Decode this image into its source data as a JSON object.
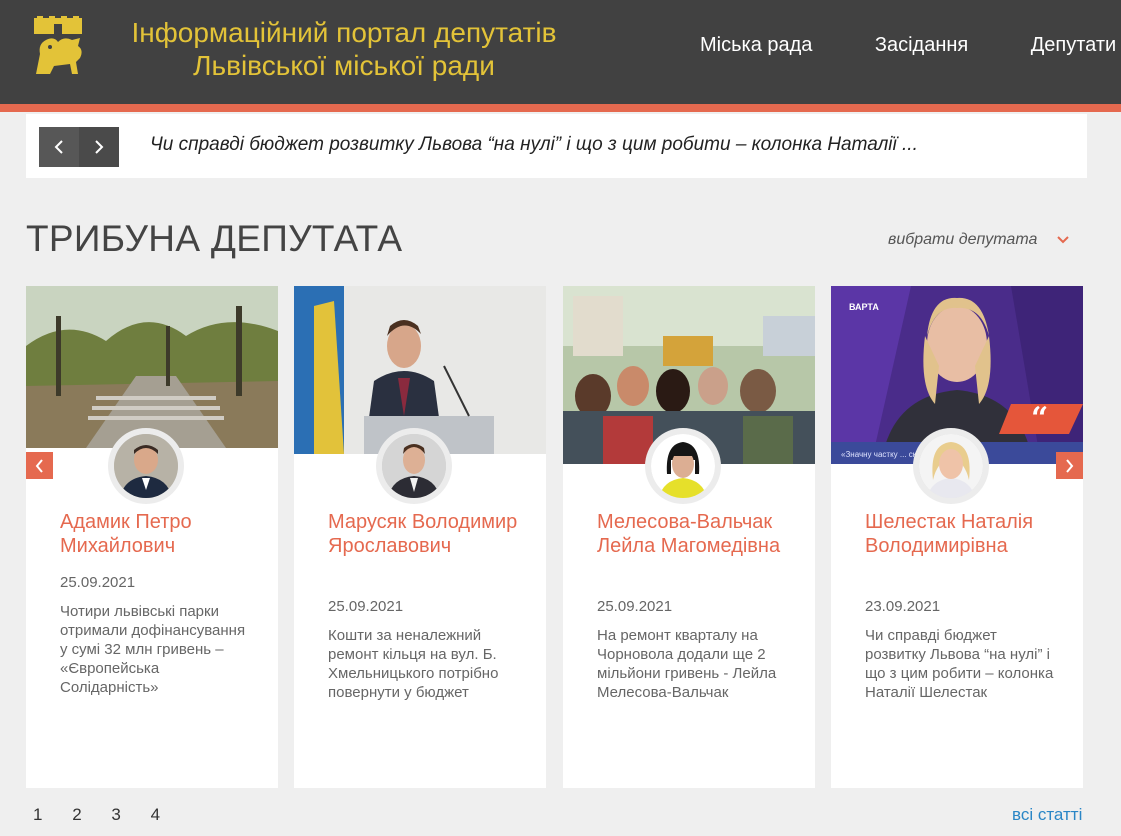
{
  "header": {
    "title_line1": "Інформаційний портал депутатів",
    "title_line2": "Львівської міської ради",
    "nav": [
      "Міська рада",
      "Засідання",
      "Депутати"
    ]
  },
  "ticker": {
    "text": "Чи справді бюджет розвитку Львова “на нулі” і що з цим робити – колонка Наталії ..."
  },
  "section": {
    "title": "ТРИБУНА ДЕПУТАТА",
    "pick_label": "вибрати депутата"
  },
  "cards": [
    {
      "name": "Адамик Петро Михайлович",
      "date": "25.09.2021",
      "excerpt": "Чотири львівські парки отримали дофінансування у сумі 32 млн гривень – «Європейська Солідарність»"
    },
    {
      "name": "Марусяк Володимир Ярославович",
      "date": "25.09.2021",
      "excerpt": "Кошти за неналежний ремонт кільця на вул. Б. Хмельницького потрібно повернути у бюджет"
    },
    {
      "name": "Мелесова-Вальчак Лейла Магомедівна",
      "date": "25.09.2021",
      "excerpt": "На ремонт кварталу на Чорновола додали ще 2 мільйони гривень - Лейла Мелесова-Вальчак"
    },
    {
      "name": "Шелестак Наталія Володимирівна",
      "date": "23.09.2021",
      "excerpt": "Чи справді бюджет розвитку Львова “на нулі” і що з цим робити – колонка Наталії Шелестак"
    }
  ],
  "card4_caption": "«Значну частку ... складають",
  "card4_brand": "ВАРТА",
  "pagination": [
    "1",
    "2",
    "3",
    "4"
  ],
  "all_articles": "всі статті",
  "colors": {
    "accent": "#e5694f",
    "header_bg": "#414141",
    "title_gold": "#e3c338",
    "link_blue": "#2a86c6"
  }
}
